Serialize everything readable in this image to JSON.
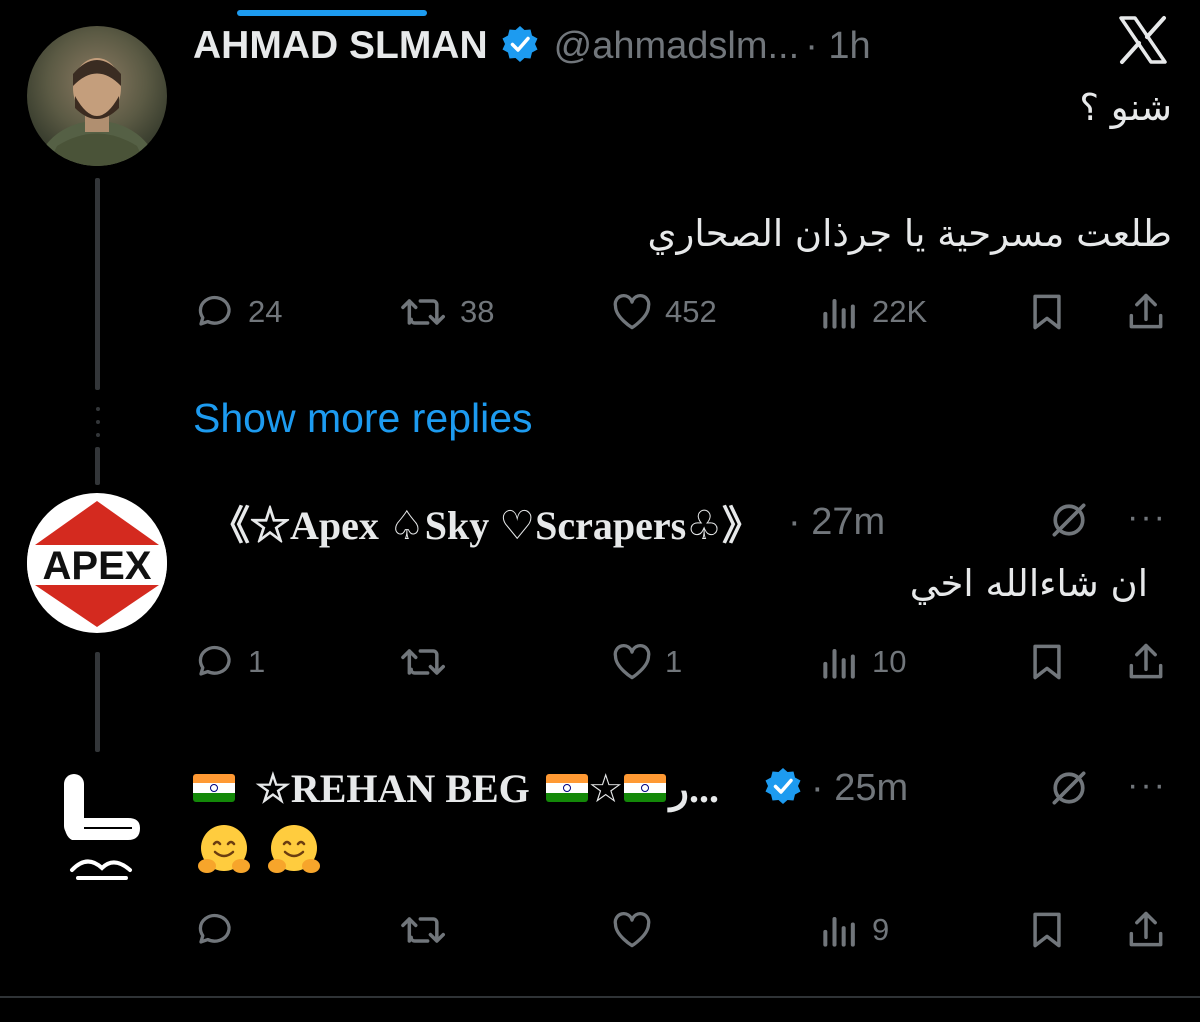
{
  "tweets": [
    {
      "author_name": "AHMAD SLMAN",
      "handle": "@ahmadslm...",
      "time": "· 1h",
      "verified": true,
      "text_line1": "شنو ؟",
      "text_line2": "طلعت مسرحية يا جرذان الصحاري",
      "replies": "24",
      "reposts": "38",
      "likes": "452",
      "views": "22K"
    },
    {
      "author_name": "《☆Apex ♤Sky ♡Scrapers♧》",
      "time": "· 27m",
      "avatar_label": "APEX",
      "text": "ان شاءالله اخي",
      "replies": "1",
      "reposts": "",
      "likes": "1",
      "views": "10",
      "more": "···"
    },
    {
      "author_name_main": "☆REHAN BEG",
      "author_name_tail": "☆",
      "author_name_rtl": "ر...",
      "time": "· 25m",
      "verified": true,
      "text": "🤗🤗",
      "views": "9",
      "more": "···"
    }
  ],
  "show_more_replies": "Show more replies",
  "colors": {
    "background": "#000000",
    "text": "#e7e9ea",
    "muted": "#71767b",
    "accent": "#1d9bf0",
    "thread_line": "#333639"
  },
  "icons": [
    "x-logo-icon",
    "verified-badge-icon",
    "reply-icon",
    "repost-icon",
    "like-icon",
    "views-icon",
    "bookmark-icon",
    "share-icon",
    "grok-icon",
    "more-icon",
    "india-flag-icon",
    "hug-emoji-icon"
  ]
}
